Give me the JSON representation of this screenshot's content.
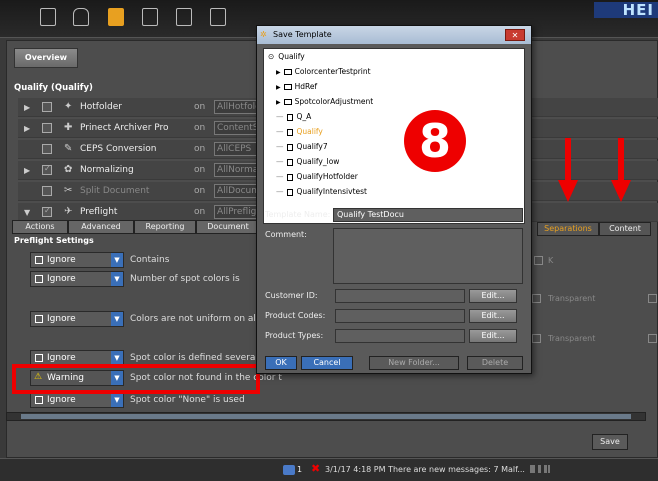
{
  "toolbar": {
    "icons": [
      "preflight-icon",
      "jobs-icon",
      "workflow-icon",
      "config-icon",
      "report-icon",
      "pages-icon"
    ],
    "active_icon": "workflow-icon",
    "logo_text": "HEI"
  },
  "overview_label": "Overview",
  "section_title": "Qualify (Qualify)",
  "sequences": [
    {
      "name": "Hotfolder",
      "on": "on",
      "field": "AllHotfolder",
      "checked": false,
      "dim": false
    },
    {
      "name": "Prinect Archiver Pro",
      "on": "on",
      "field": "ContentS",
      "checked": false,
      "dim": false
    },
    {
      "name": "CEPS Conversion",
      "on": "on",
      "field": "AllCEPS",
      "checked": false,
      "dim": false
    },
    {
      "name": "Normalizing",
      "on": "on",
      "field": "AllNormal",
      "checked": true,
      "dim": false
    },
    {
      "name": "Split Document",
      "on": "on",
      "field": "AllDocum",
      "checked": false,
      "dim": true
    },
    {
      "name": "Preflight",
      "on": "on",
      "field": "AllPreflight",
      "checked": true,
      "dim": false
    }
  ],
  "tabs": [
    "Actions",
    "Advanced",
    "Reporting",
    "Document"
  ],
  "preflight_settings_title": "Preflight Settings",
  "settings": [
    {
      "action": "Ignore",
      "label": "Contains"
    },
    {
      "action": "Ignore",
      "label": "Number of spot colors is"
    },
    {
      "action": "Ignore",
      "label": "Colors are not uniform on all pag"
    },
    {
      "action": "Ignore",
      "label": "Spot color is defined several time"
    },
    {
      "action": "Warning",
      "label": "Spot color not found in the color t"
    },
    {
      "action": "Ignore",
      "label": "Spot color \"None\" is used"
    }
  ],
  "right_tabs": [
    "Separations",
    "Content"
  ],
  "right_panel": {
    "k_label": "K",
    "transparent_1": "Transparent",
    "transparent_2": "Transparent"
  },
  "save_label": "Save",
  "status": {
    "count": "1",
    "message": "3/1/17 4:18 PM  There are new messages: 7 Malf..."
  },
  "dialog": {
    "title": "Save Template",
    "close_label": "✕",
    "tree": [
      {
        "label": "Qualify",
        "type": "root",
        "indent": 0,
        "selected": false
      },
      {
        "label": "ColorcenterTestprint",
        "type": "folder",
        "indent": 1,
        "selected": false
      },
      {
        "label": "HdRef",
        "type": "folder",
        "indent": 1,
        "selected": false
      },
      {
        "label": "SpotcolorAdjustment",
        "type": "folder",
        "indent": 1,
        "selected": false
      },
      {
        "label": "Q_A",
        "type": "file",
        "indent": 1,
        "selected": false
      },
      {
        "label": "Qualify",
        "type": "file",
        "indent": 1,
        "selected": true
      },
      {
        "label": "Qualify7",
        "type": "file",
        "indent": 1,
        "selected": false
      },
      {
        "label": "Qualify_low",
        "type": "file",
        "indent": 1,
        "selected": false
      },
      {
        "label": "QualifyHotfolder",
        "type": "file",
        "indent": 1,
        "selected": false
      },
      {
        "label": "QualifyIntensivtest",
        "type": "file",
        "indent": 1,
        "selected": false
      }
    ],
    "step_badge": "8",
    "template_name_label": "Template Name:",
    "template_name_value": "Qualify TestDocu",
    "comment_label": "Comment:",
    "customer_id_label": "Customer ID:",
    "product_codes_label": "Product Codes:",
    "product_types_label": "Product Types:",
    "edit_label": "Edit...",
    "ok_label": "OK",
    "cancel_label": "Cancel",
    "new_folder_label": "New Folder...",
    "delete_label": "Delete"
  },
  "colors": {
    "accent": "#e8a020",
    "highlight": "#e00000",
    "dialog_title": "#b8c8dc"
  }
}
